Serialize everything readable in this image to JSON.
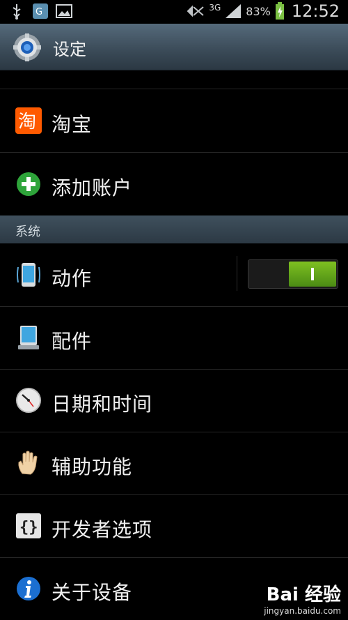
{
  "status_bar": {
    "network": "3G",
    "battery": "83%",
    "time": "12:52"
  },
  "title_bar": {
    "title": "设定",
    "icon": "settings-gear-icon"
  },
  "list": {
    "taobao": {
      "label": "淘宝",
      "icon": "taobao-icon"
    },
    "add_account": {
      "label": "添加账户",
      "icon": "plus-circle-icon"
    },
    "section_system": "系统",
    "motion": {
      "label": "动作",
      "icon": "phone-motion-icon",
      "toggle_on": true
    },
    "accessory": {
      "label": "配件",
      "icon": "accessory-icon"
    },
    "date_time": {
      "label": "日期和时间",
      "icon": "clock-icon"
    },
    "accessibility": {
      "label": "辅助功能",
      "icon": "hand-icon"
    },
    "developer": {
      "label": "开发者选项",
      "icon": "braces-icon"
    },
    "about": {
      "label": "关于设备",
      "icon": "info-icon"
    }
  },
  "watermark": {
    "brand": "Bai 经验",
    "url": "jingyan.baidu.com"
  },
  "colors": {
    "title_bar": "#3a4a57",
    "toggle_on": "#5fa11a",
    "taobao": "#ff5a00",
    "add_green": "#2ea43a",
    "info_blue": "#1b6fd1"
  }
}
